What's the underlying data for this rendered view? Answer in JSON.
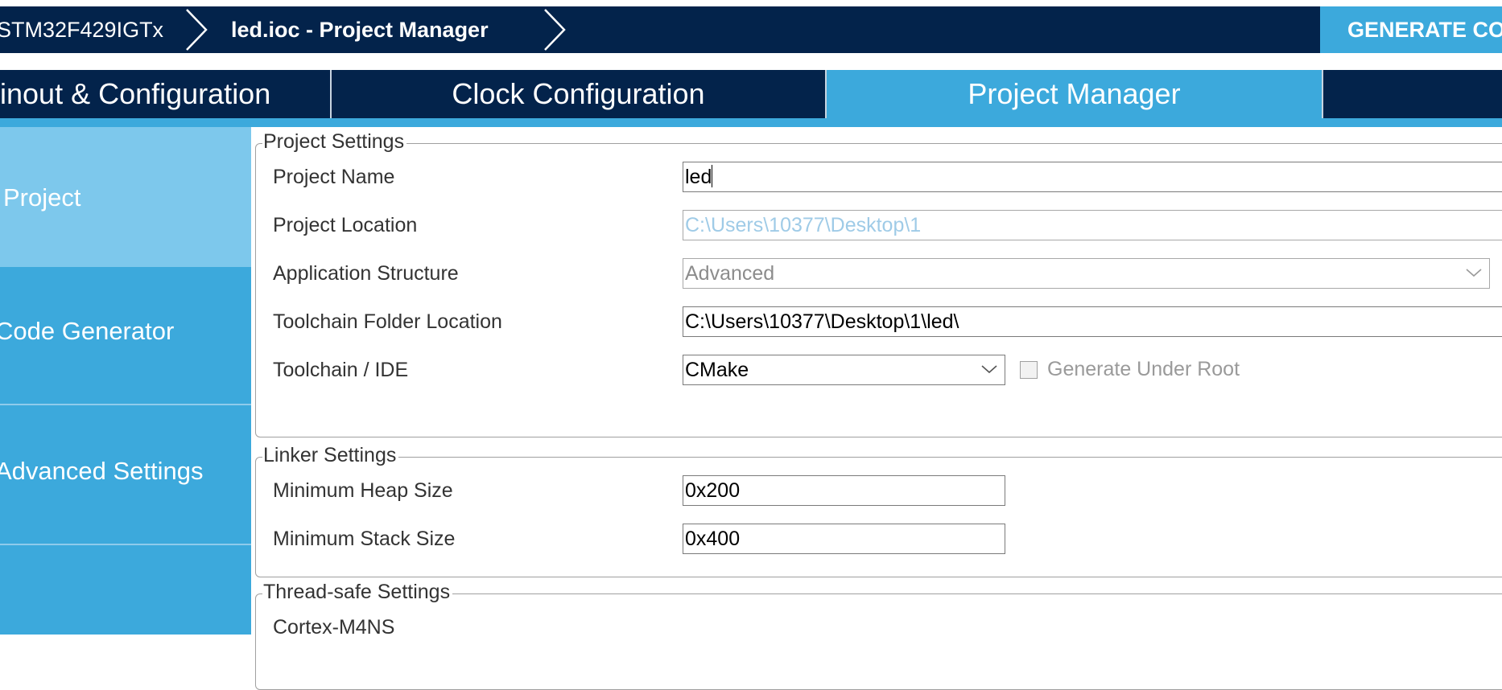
{
  "breadcrumb": {
    "device": "STM32F429IGTx",
    "file": "led.ioc - Project Manager"
  },
  "header": {
    "generate_button": "GENERATE CODE"
  },
  "tabs": [
    {
      "label": "Pinout & Configuration"
    },
    {
      "label": "Clock Configuration"
    },
    {
      "label": "Project Manager"
    },
    {
      "label": ""
    }
  ],
  "sidebar": {
    "items": [
      {
        "label": "Project"
      },
      {
        "label": "Code Generator"
      },
      {
        "label": "Advanced Settings"
      }
    ]
  },
  "project_settings": {
    "legend": "Project Settings",
    "project_name": {
      "label": "Project Name",
      "value": "led"
    },
    "project_location": {
      "label": "Project Location",
      "value": "C:\\Users\\10377\\Desktop\\1"
    },
    "application_structure": {
      "label": "Application Structure",
      "value": "Advanced"
    },
    "toolchain_folder": {
      "label": "Toolchain Folder Location",
      "value": "C:\\Users\\10377\\Desktop\\1\\led\\"
    },
    "toolchain_ide": {
      "label": "Toolchain / IDE",
      "value": "CMake"
    },
    "generate_under_root": {
      "label": "Generate Under Root",
      "checked": false
    }
  },
  "linker_settings": {
    "legend": "Linker Settings",
    "heap": {
      "label": "Minimum Heap Size",
      "value": "0x200"
    },
    "stack": {
      "label": "Minimum Stack Size",
      "value": "0x400"
    }
  },
  "thread_safe_settings": {
    "legend": "Thread-safe Settings",
    "core_label": "Cortex-M4NS"
  },
  "colors": {
    "navy": "#03234b",
    "accent_blue": "#3ca9dc",
    "selected_side": "#7dc8ec"
  }
}
